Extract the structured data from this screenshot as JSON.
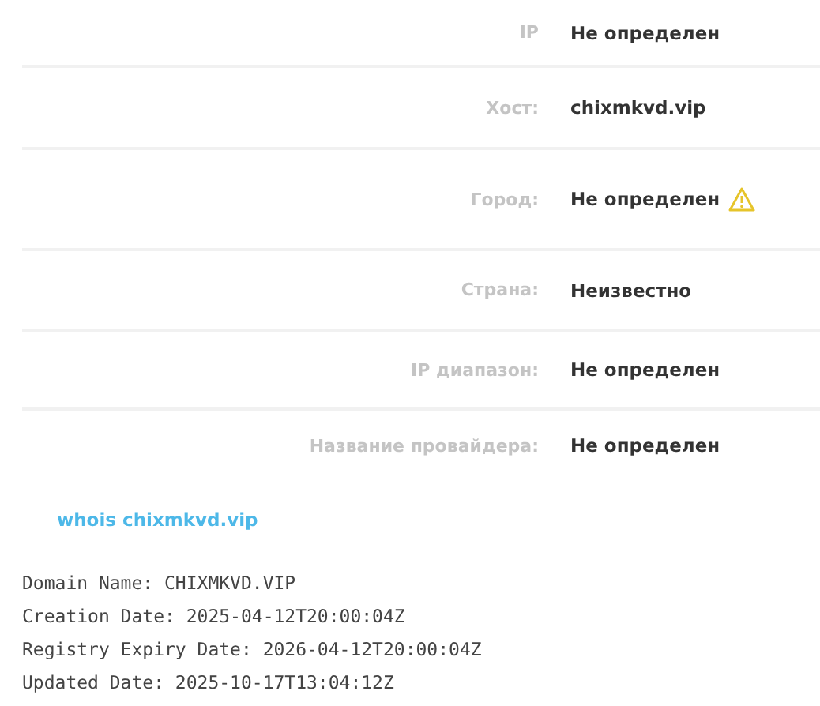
{
  "info_rows": [
    {
      "label": "IP",
      "value": "Не определен",
      "warning": false
    },
    {
      "label": "Хост:",
      "value": "chixmkvd.vip",
      "warning": false
    },
    {
      "label": "Город:",
      "value": "Не определен",
      "warning": true
    },
    {
      "label": "Страна:",
      "value": "Неизвестно",
      "warning": false
    },
    {
      "label": "IP диапазон:",
      "value": "Не определен",
      "warning": false
    },
    {
      "label": "Название провайдера:",
      "value": "Не определен",
      "warning": false
    }
  ],
  "whois_link": "whois chixmkvd.vip",
  "whois_lines": [
    "Domain Name: CHIXMKVD.VIP",
    "Creation Date: 2025-04-12T20:00:04Z",
    "Registry Expiry Date: 2026-04-12T20:00:04Z",
    "Updated Date: 2025-10-17T13:04:12Z"
  ]
}
